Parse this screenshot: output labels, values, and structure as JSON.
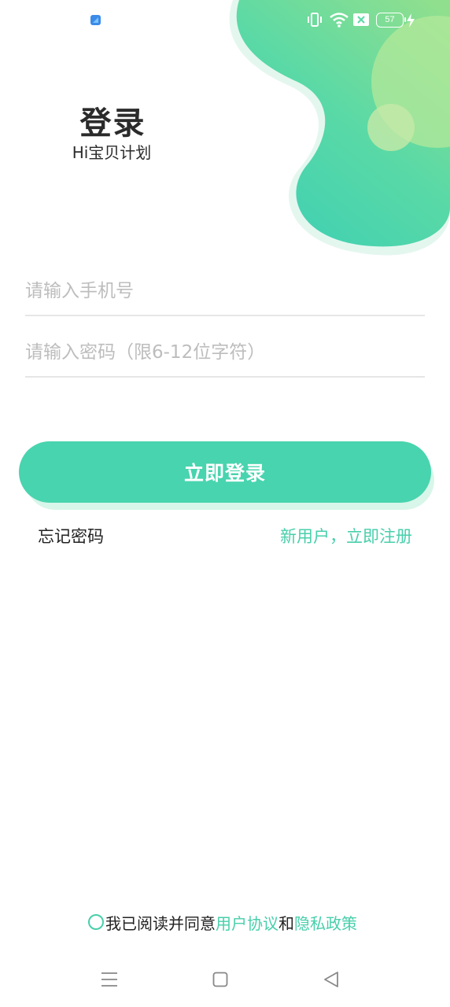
{
  "status_bar": {
    "battery_level": "57",
    "icons": [
      "app-notification-icon",
      "vibrate-icon",
      "wifi-icon",
      "sim-no-signal-icon",
      "battery-icon",
      "charging-icon"
    ]
  },
  "header": {
    "title": "登录",
    "subtitle": "Hi宝贝计划"
  },
  "form": {
    "phone_placeholder": "请输入手机号",
    "password_placeholder": "请输入密码（限6-12位字符）",
    "login_label": "立即登录"
  },
  "links": {
    "forgot_password": "忘记密码",
    "register": "新用户，立即注册"
  },
  "agreement": {
    "prefix": "我已阅读并同意",
    "user_agreement": "用户协议",
    "conjunction": "和",
    "privacy_policy": "隐私政策",
    "checked": false
  },
  "navigation": {
    "icons": [
      "menu-icon",
      "home-icon",
      "back-icon"
    ]
  },
  "colors": {
    "accent": "#48d4ae",
    "link": "#48cfab",
    "blob_gradient": [
      "#a6e59a",
      "#4fd6b0"
    ],
    "text": "#222222",
    "placeholder": "#bdbdbd"
  }
}
